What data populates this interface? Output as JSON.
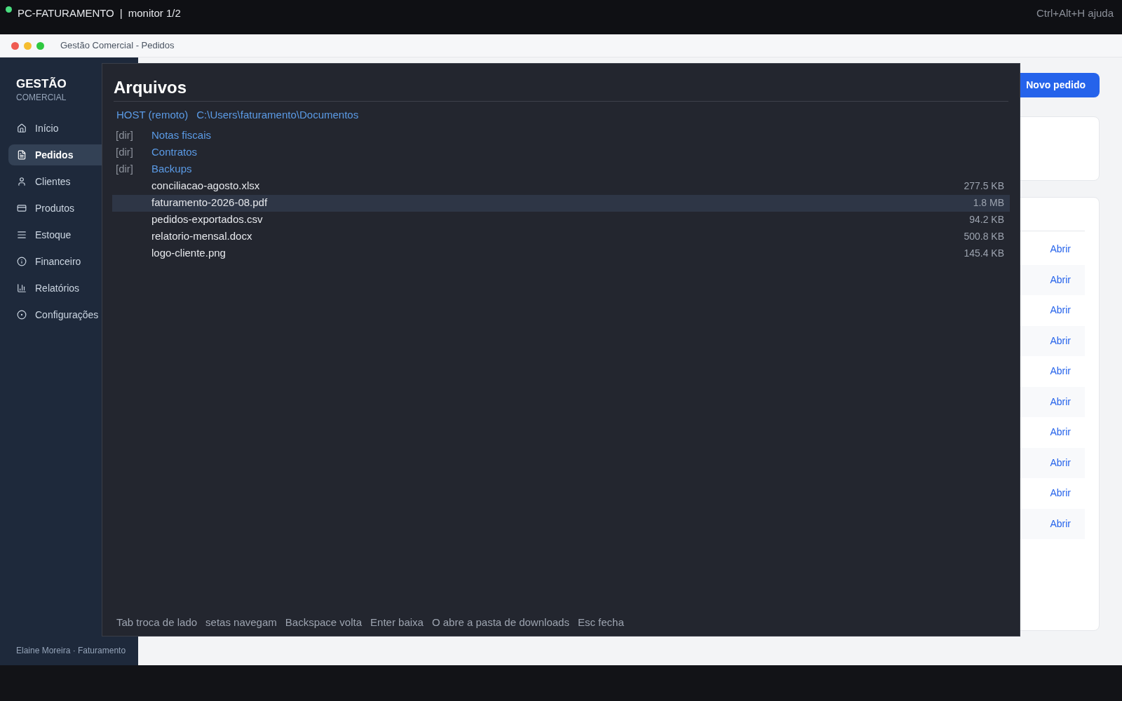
{
  "top_bar": {
    "host": "PC-FATURAMENTO",
    "separator": "|",
    "monitor": "monitor 1/2",
    "help": "Ctrl+Alt+H ajuda"
  },
  "window": {
    "title": "Gestão Comercial - Pedidos"
  },
  "sidebar": {
    "brand": "GESTÃO",
    "subtitle": "COMERCIAL",
    "items": [
      {
        "label": "Início",
        "selected": false
      },
      {
        "label": "Pedidos",
        "selected": true
      },
      {
        "label": "Clientes",
        "selected": false
      },
      {
        "label": "Produtos",
        "selected": false
      },
      {
        "label": "Estoque",
        "selected": false
      },
      {
        "label": "Financeiro",
        "selected": false
      },
      {
        "label": "Relatórios",
        "selected": false
      },
      {
        "label": "Configurações",
        "selected": false
      }
    ],
    "footer": "Elaine Moreira · Faturamento"
  },
  "main": {
    "primary_button": "Novo pedido",
    "rows": [
      {
        "action": "Abrir"
      },
      {
        "action": "Abrir"
      },
      {
        "action": "Abrir"
      },
      {
        "action": "Abrir"
      },
      {
        "action": "Abrir"
      },
      {
        "action": "Abrir"
      },
      {
        "action": "Abrir"
      },
      {
        "action": "Abrir"
      },
      {
        "action": "Abrir"
      },
      {
        "action": "Abrir"
      }
    ]
  },
  "file_dialog": {
    "title": "Arquivos",
    "location": "HOST (remoto)",
    "path": "C:\\Users\\faturamento\\Documentos",
    "entries": [
      {
        "kind": "dir",
        "tag": "[dir]",
        "name": "Notas fiscais",
        "selected": false
      },
      {
        "kind": "dir",
        "tag": "[dir]",
        "name": "Contratos",
        "selected": false
      },
      {
        "kind": "dir",
        "tag": "[dir]",
        "name": "Backups",
        "selected": false
      },
      {
        "kind": "file",
        "name": "conciliacao-agosto.xlsx",
        "size": "277.5 KB",
        "selected": false
      },
      {
        "kind": "file",
        "name": "faturamento-2026-08.pdf",
        "size": "1.8 MB",
        "selected": true
      },
      {
        "kind": "file",
        "name": "pedidos-exportados.csv",
        "size": "94.2 KB",
        "selected": false
      },
      {
        "kind": "file",
        "name": "relatorio-mensal.docx",
        "size": "500.8 KB",
        "selected": false
      },
      {
        "kind": "file",
        "name": "logo-cliente.png",
        "size": "145.4 KB",
        "selected": false
      }
    ],
    "hints": [
      "Tab troca de lado",
      "setas navegam",
      "Backspace volta",
      "Enter baixa",
      "O abre a pasta de downloads",
      "Esc fecha"
    ]
  }
}
